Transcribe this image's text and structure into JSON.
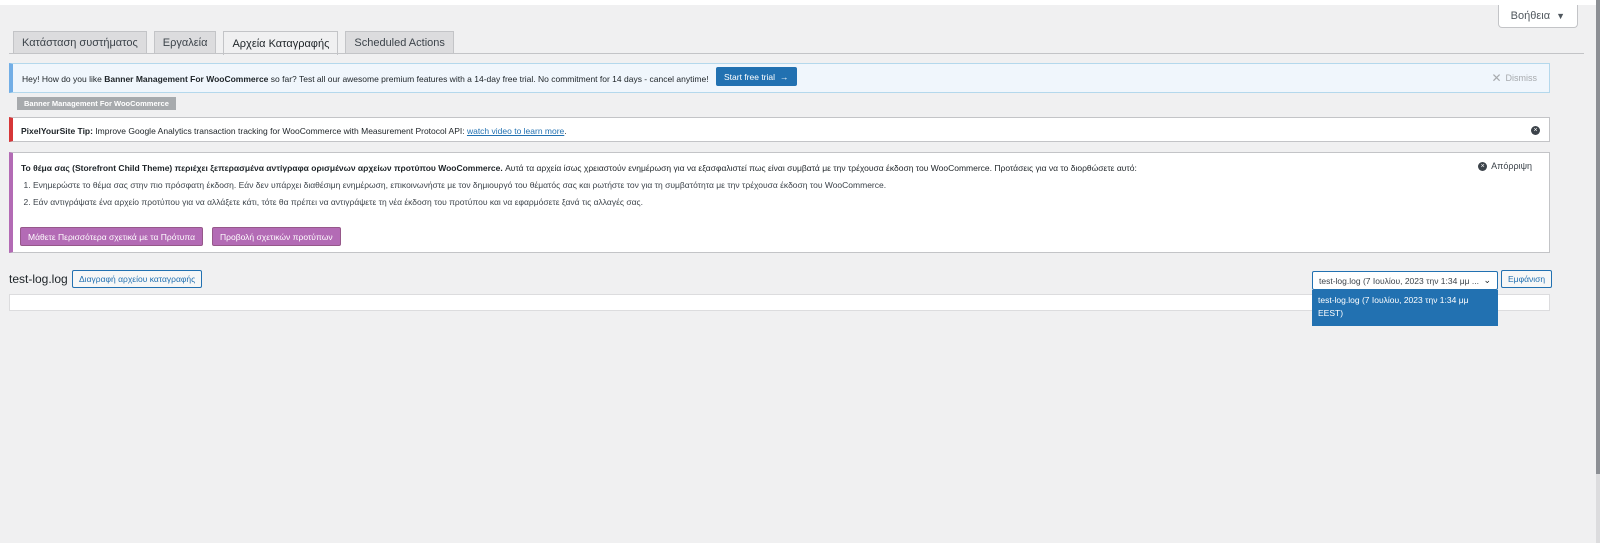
{
  "help": {
    "label": "Βοήθεια",
    "caret": "▼"
  },
  "tabs": [
    {
      "label": "Κατάσταση συστήματος"
    },
    {
      "label": "Εργαλεία"
    },
    {
      "label": "Αρχεία Καταγραφής"
    },
    {
      "label": "Scheduled Actions"
    }
  ],
  "banner_notice": {
    "pre": "Hey! How do you like ",
    "plugin": "Banner Management For WooCommerce",
    "post": " so far? Test all our awesome premium features with a 14-day free trial. No commitment for 14 days - cancel anytime!",
    "trial_label": "Start free trial",
    "trial_arrow": "→",
    "dismiss_label": "Dismiss",
    "dismiss_icon": "✕",
    "tag": "Banner Management For WooCommerce"
  },
  "pixel_notice": {
    "lead": "PixelYourSite Tip:",
    "text": " Improve Google Analytics transaction tracking for WooCommerce with Measurement Protocol API: ",
    "link": "watch video to learn more",
    "end": ".",
    "close_icon": "×"
  },
  "theme_notice": {
    "bold": "Το θέμα σας (Storefront Child Theme) περιέχει ξεπερασμένα αντίγραφα ορισμένων αρχείων προτύπου WooCommerce.",
    "text": " Αυτά τα αρχεία ίσως χρειαστούν ενημέρωση για να εξασφαλιστεί πως είναι συμβατά με την τρέχουσα έκδοση του WooCommerce. Προτάσεις για να το διορθώσετε αυτό:",
    "items": [
      "Ενημερώστε το θέμα σας στην πιο πρόσφατη έκδοση. Εάν δεν υπάρχει διαθέσιμη ενημέρωση, επικοινωνήστε με τον δημιουργό του θέματός σας και ρωτήστε τον για τη συμβατότητα με την τρέχουσα έκδοση του WooCommerce.",
      "Εάν αντιγράψατε ένα αρχείο προτύπου για να αλλάξετε κάτι, τότε θα πρέπει να αντιγράψετε τη νέα έκδοση του προτύπου και να εφαρμόσετε ξανά τις αλλαγές σας."
    ],
    "ignore_label": "Απόρριψη",
    "ignore_icon": "×",
    "learn_more_label": "Μάθετε Περισσότερα σχετικά με τα Πρότυπα",
    "view_templates_label": "Προβολή σχετικών προτύπων"
  },
  "log": {
    "title": "test-log.log",
    "delete_label": "Διαγραφή αρχείου καταγραφής",
    "select_value": "test-log.log (7 Ιουλίου, 2023 την 1:34 μμ ...",
    "select_chevron": "⌄",
    "options": [
      "test-log.log (7 Ιουλίου, 2023 την 1:34 μμ EEST)"
    ],
    "view_label": "Εμφάνιση"
  }
}
